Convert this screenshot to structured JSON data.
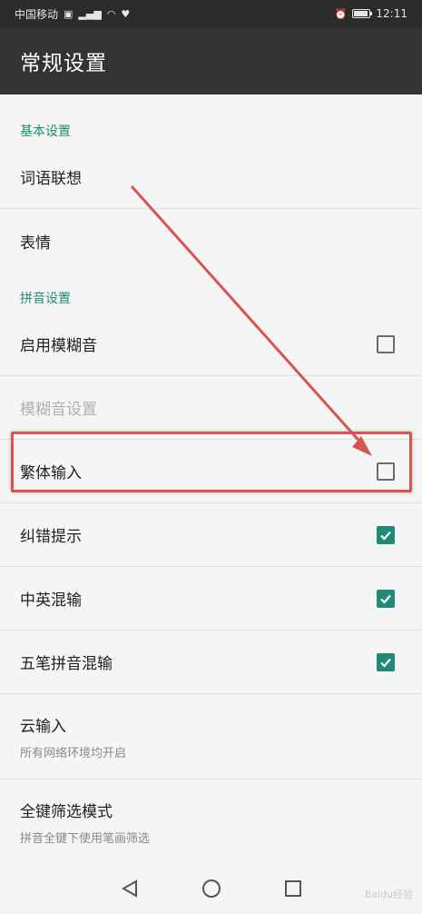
{
  "status_bar": {
    "carrier": "中国移动",
    "time": "12:11"
  },
  "app_bar": {
    "title": "常规设置"
  },
  "sections": [
    {
      "header": "基本设置"
    },
    {
      "header": "拼音设置"
    }
  ],
  "rows": {
    "word_association": {
      "label": "词语联想"
    },
    "emoji": {
      "label": "表情"
    },
    "fuzzy_pinyin": {
      "label": "启用模糊音",
      "checked": false
    },
    "fuzzy_settings": {
      "label": "模糊音设置",
      "enabled": false
    },
    "traditional_input": {
      "label": "繁体输入",
      "checked": false
    },
    "error_hint": {
      "label": "纠错提示",
      "checked": true
    },
    "cn_en_mixed": {
      "label": "中英混输",
      "checked": true
    },
    "wubi_pinyin_mixed": {
      "label": "五笔拼音混输",
      "checked": true
    },
    "cloud_input": {
      "label": "云输入",
      "subtitle": "所有网络环境均开启"
    },
    "full_key_filter": {
      "label": "全键筛选模式",
      "subtitle": "拼音全键下使用笔画筛选"
    }
  },
  "colors": {
    "accent": "#1f8a78",
    "app_bar": "#333333",
    "status_bar": "#2b2b2b",
    "annotation": "#d9534f"
  },
  "watermark": "Baidu经验"
}
